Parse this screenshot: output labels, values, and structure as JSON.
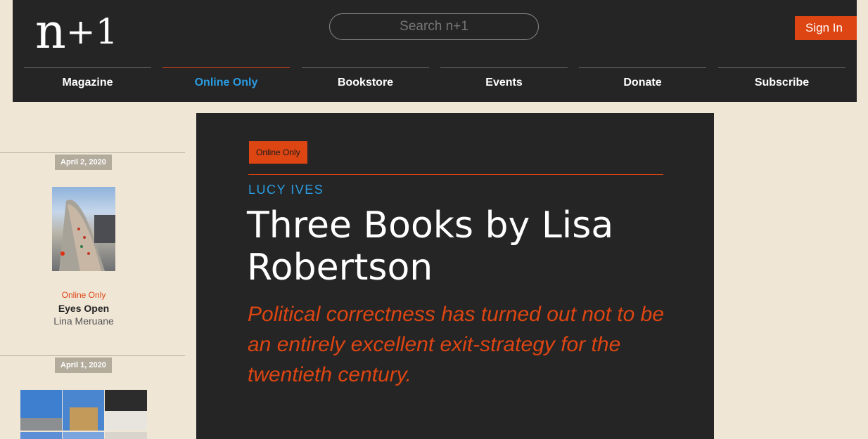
{
  "header": {
    "logo": {
      "letter": "n",
      "plus": "+1"
    },
    "search": {
      "placeholder": "Search n+1"
    },
    "signin_label": "Sign In",
    "nav": [
      {
        "label": "Magazine",
        "active": false
      },
      {
        "label": "Online Only",
        "active": true
      },
      {
        "label": "Bookstore",
        "active": false
      },
      {
        "label": "Events",
        "active": false
      },
      {
        "label": "Donate",
        "active": false
      },
      {
        "label": "Subscribe",
        "active": false
      }
    ]
  },
  "sidebar": {
    "items": [
      {
        "date": "April 2, 2020",
        "category": "Online Only",
        "title": "Eyes Open",
        "author": "Lina Meruane"
      },
      {
        "date": "April 1, 2020"
      }
    ]
  },
  "article": {
    "tag": "Online Only",
    "author": "LUCY IVES",
    "title": "Three Books by Lisa Robertson",
    "dek": "Political correctness has turned out not to be an entirely excellent exit-strategy for the twentieth century."
  },
  "colors": {
    "accent": "#dd4512",
    "link_blue": "#2a9be0",
    "dark_bg": "#252525",
    "page_bg": "#efe6d6"
  }
}
